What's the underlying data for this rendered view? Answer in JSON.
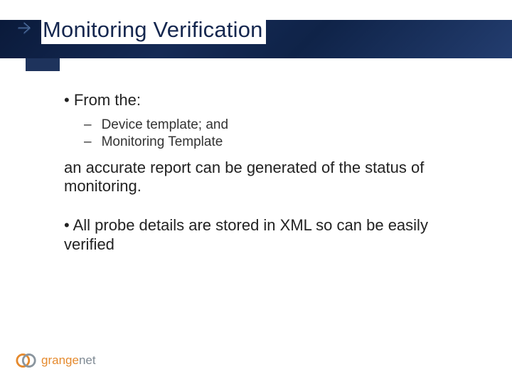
{
  "title": "Monitoring Verification",
  "body": {
    "bullet1_intro": "• From the:",
    "sub1": "Device template; and",
    "sub2": "Monitoring Template",
    "bullet1_outro": "an accurate report can be generated of the status of monitoring.",
    "bullet2": "• All probe details are stored in XML so can be easily verified"
  },
  "footer": {
    "brand_part1": "grange",
    "brand_part2": "net"
  }
}
